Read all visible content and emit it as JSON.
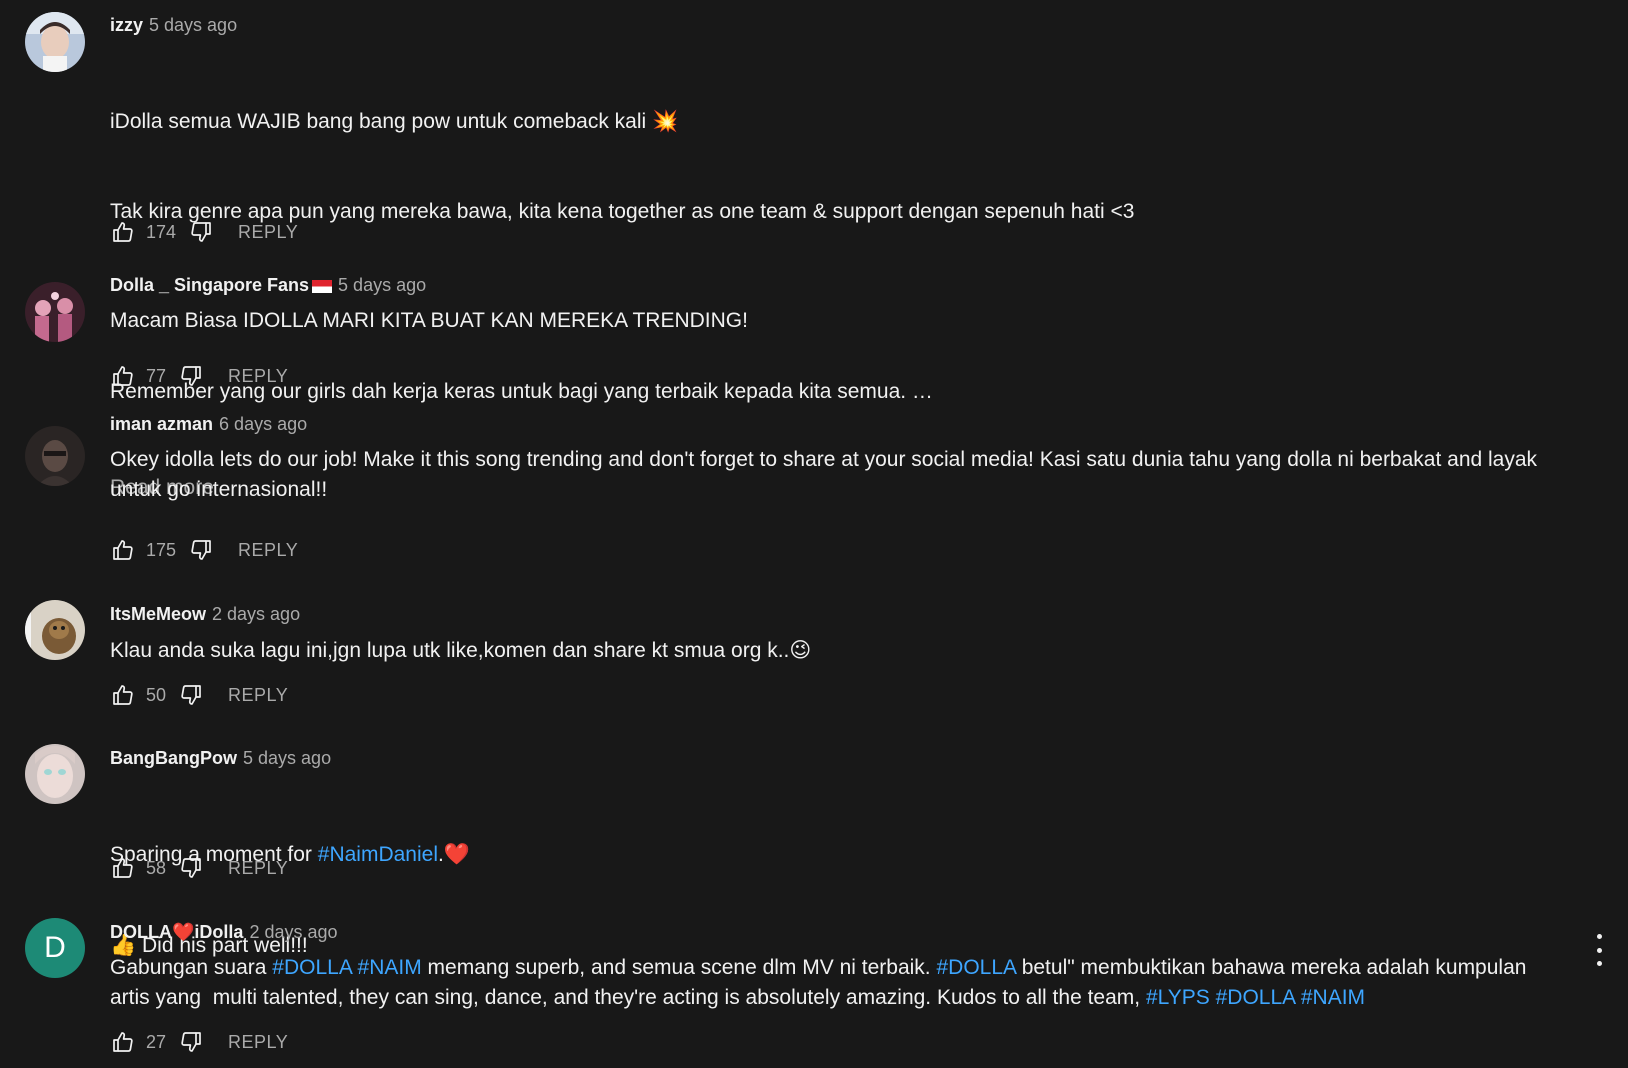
{
  "comments": [
    {
      "author": "izzy",
      "time": "5 days ago",
      "lines": [
        "iDolla semua WAJIB bang bang pow untuk comeback kali ",
        "Tak kira genre apa pun yang mereka bawa, kita kena together as one team & support dengan sepenuh hati <3",
        "Remember yang our girls dah kerja keras untuk bagi yang terbaik kepada kita semua. …"
      ],
      "emoji_1": "💥",
      "read_more": "Read more",
      "likes": "174",
      "reply": "REPLY"
    },
    {
      "author": "Dolla _ Singapore Fans",
      "time": "5 days ago",
      "text": "Macam Biasa IDOLLA MARI KITA BUAT KAN MEREKA TRENDING!",
      "likes": "77",
      "reply": "REPLY"
    },
    {
      "author": "iman azman",
      "time": "6 days ago",
      "text": "Okey idolla lets do our job! Make it this song trending and don't forget to share at your social media! Kasi satu dunia tahu yang dolla ni berbakat and layak untuk go internasional!!",
      "likes": "175",
      "reply": "REPLY"
    },
    {
      "author": "ItsMeMeow",
      "time": "2 days ago",
      "text": "Klau anda suka lagu ini,jgn lupa utk like,komen dan share kt smua org k..",
      "emoji": "😉",
      "likes": "50",
      "reply": "REPLY"
    },
    {
      "author": "BangBangPow",
      "time": "5 days ago",
      "text_before": "Sparing a moment for ",
      "hashtag": "#NaimDaniel",
      "text_after": ".",
      "emoji_heart": "❤️",
      "emoji_thumb": "👍",
      "line2": " Did his part well!!!",
      "likes": "58",
      "reply": "REPLY"
    },
    {
      "author_a": "DOLLA",
      "author_heart": "❤️",
      "author_b": "iDolla",
      "avatar_letter": "D",
      "time": "2 days ago",
      "t1": "Gabungan suara ",
      "h1": "#DOLLA",
      "t2": " ",
      "h2": "#NAIM",
      "t3": " memang superb, and semua scene dlm MV ni terbaik. ",
      "h3": "#DOLLA",
      "t4": " betul\" membuktikan bahawa mereka adalah kumpulan artis yang  multi talented, they can sing, dance, and they're acting is absolutely amazing. Kudos to all the team, ",
      "h4": "#LYPS",
      "t5": " ",
      "h5": "#DOLLA",
      "t6": " ",
      "h6": "#NAIM",
      "likes": "27",
      "reply": "REPLY"
    }
  ],
  "colors": {
    "background": "#181818",
    "text": "#f1f1f1",
    "muted": "#aaaaaa",
    "link": "#3ea6ff",
    "avatar_teal": "#1d8a76"
  }
}
